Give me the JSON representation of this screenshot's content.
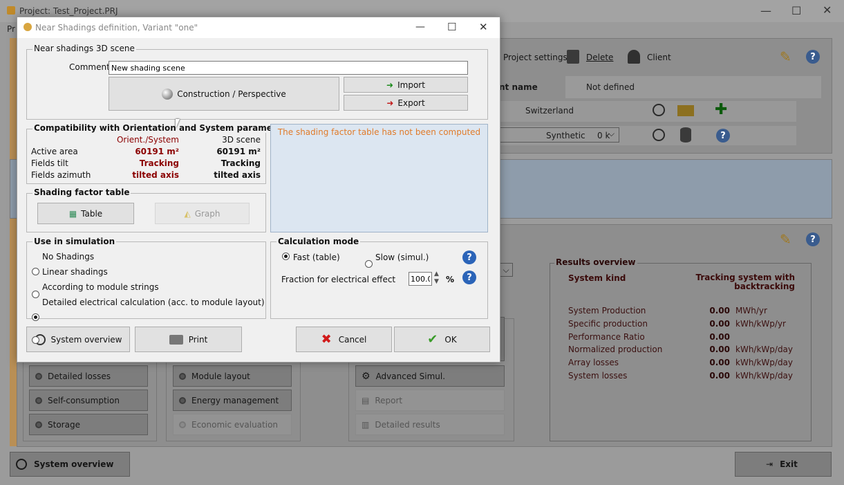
{
  "main": {
    "title": "Project:  Test_Project.PRJ",
    "menu_stub": "Pr",
    "toolbar": {
      "project_settings": "Project settings",
      "delete": "Delete",
      "client": "Client"
    },
    "site": {
      "label": "nt name",
      "value": "Not defined",
      "country": "Switzerland",
      "meteo": "Synthetic",
      "meteo_extra": "0 k"
    },
    "buttons": {
      "detailed_losses": "Detailed losses",
      "self_consumption": "Self-consumption",
      "storage": "Storage",
      "module_layout": "Module layout",
      "energy_management": "Energy management",
      "economic_evaluation": "Economic evaluation",
      "advanced_simul": "Advanced Simul.",
      "report": "Report",
      "detailed_results": "Detailed results",
      "system_overview": "System overview",
      "exit": "Exit"
    },
    "results": {
      "title": "Results overview",
      "system_kind_label": "System kind",
      "system_kind_value": "Tracking system with backtracking",
      "rows": [
        {
          "label": "System Production",
          "value": "0.00",
          "unit": "MWh/yr"
        },
        {
          "label": "Specific production",
          "value": "0.00",
          "unit": "kWh/kWp/yr"
        },
        {
          "label": "Performance Ratio",
          "value": "0.00",
          "unit": ""
        },
        {
          "label": "Normalized production",
          "value": "0.00",
          "unit": "kWh/kWp/day"
        },
        {
          "label": "Array losses",
          "value": "0.00",
          "unit": "kWh/kWp/day"
        },
        {
          "label": "System losses",
          "value": "0.00",
          "unit": "kWh/kWp/day"
        }
      ]
    }
  },
  "dialog": {
    "title": "Near Shadings definition, Variant \"one\"",
    "scene": {
      "group_title": "Near shadings 3D scene",
      "comment_label": "Comment",
      "comment_value": "New shading scene",
      "construction": "Construction / Perspective",
      "import": "Import",
      "export": "Export"
    },
    "compat": {
      "group_title": "Compatibility with Orientation and System parameter",
      "col1": "Orient./System",
      "col2": "3D scene",
      "rows": [
        {
          "label": "Active area",
          "v1": "60191 m²",
          "v2": "60191 m²"
        },
        {
          "label": "Fields tilt",
          "v1": "Tracking",
          "v2": "Tracking"
        },
        {
          "label": "Fields azimuth",
          "v1": "tilted axis",
          "v2": "tilted axis"
        }
      ]
    },
    "info_message": "The shading factor table has not been computed",
    "shading_table": {
      "group_title": "Shading factor table",
      "table": "Table",
      "graph": "Graph"
    },
    "use_sim": {
      "group_title": "Use in simulation",
      "options": [
        "No Shadings",
        "Linear shadings",
        "According to module strings",
        "Detailed electrical calculation (acc. to module layout)"
      ],
      "selected_index": 2
    },
    "calc_mode": {
      "group_title": "Calculation mode",
      "fast": "Fast (table)",
      "slow": "Slow (simul.)",
      "fraction_label": "Fraction for electrical effect",
      "fraction_value": "100.0",
      "fraction_unit": "%"
    },
    "buttons": {
      "system_overview": "System overview",
      "print": "Print",
      "cancel": "Cancel",
      "ok": "OK"
    }
  }
}
